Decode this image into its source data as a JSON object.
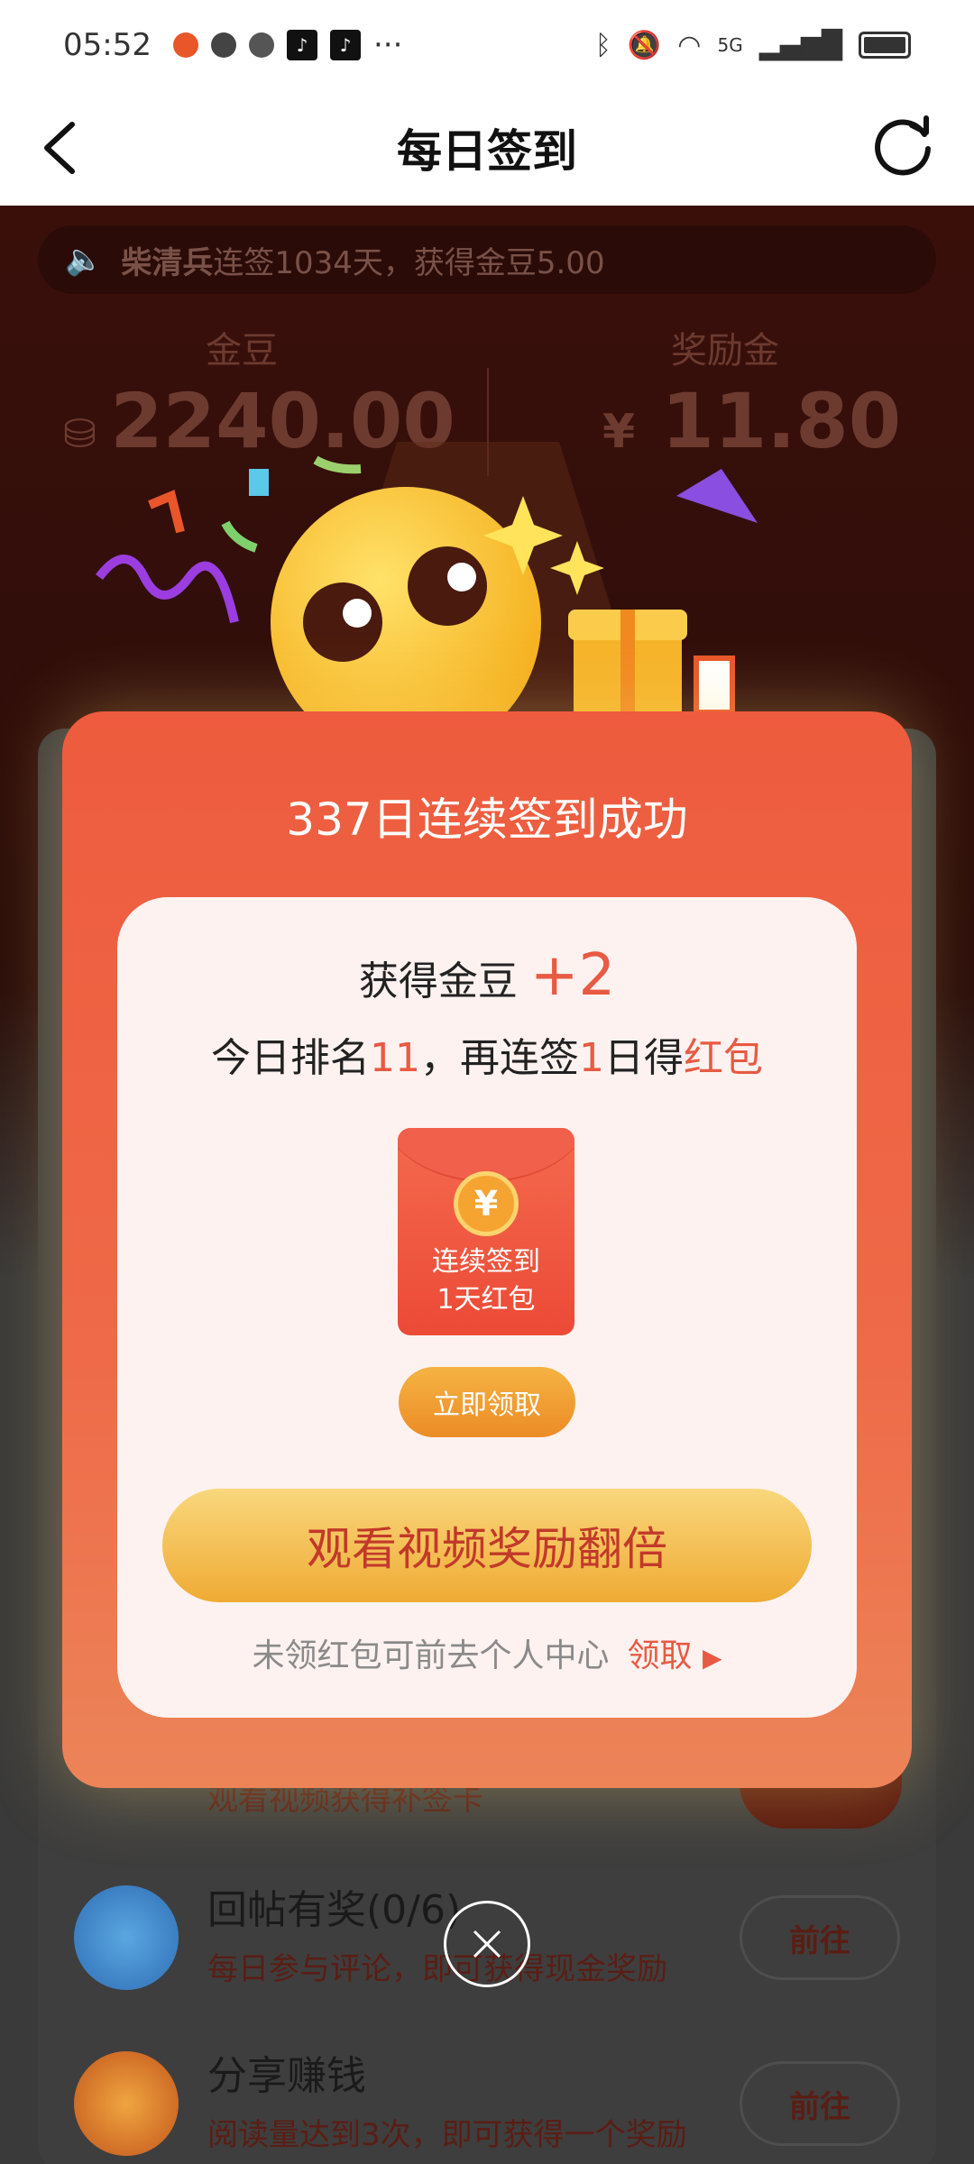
{
  "status_bar": {
    "time": "05:52",
    "network": "5G"
  },
  "header": {
    "title": "每日签到"
  },
  "notice": {
    "name": "柴清兵",
    "text": "连签1034天，获得金豆5.00"
  },
  "stats": {
    "beans_label": "金豆",
    "beans_value": "2240.00",
    "reward_label": "奖励金",
    "reward_currency": "¥",
    "reward_value": "11.80"
  },
  "modal": {
    "title": "337日连续签到成功",
    "reward_prefix": "获得金豆",
    "reward_amount": "+2",
    "rank_prefix": "今日排名",
    "rank_value": "11",
    "rank_middle": "，再连签",
    "rank_days": "1",
    "rank_suffix": "日得",
    "rank_prize": "红包",
    "packet_icon": "¥",
    "packet_line1": "连续签到",
    "packet_line2": "1天红包",
    "claim_label": "立即领取",
    "watch_label": "观看视频奖励翻倍",
    "note_text": "未领红包可前去个人中心",
    "note_link": "领取"
  },
  "tasks": [
    {
      "title": "回帖有奖(0/6)",
      "desc": "每日参与评论，即可获得现金奖励",
      "button": "前往"
    },
    {
      "title": "分享赚钱",
      "desc": "阅读量达到3次，即可获得一个奖励",
      "button": "前往"
    }
  ],
  "partial_task_desc": "观看视频获得补签卡",
  "colors": {
    "accent": "#ee5b3e",
    "gold": "#efab34",
    "link": "#e85a43"
  }
}
